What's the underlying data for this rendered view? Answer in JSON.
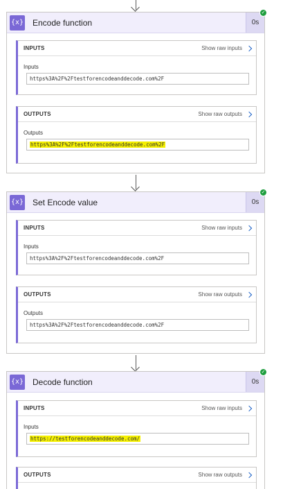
{
  "cards": [
    {
      "title": "Encode function",
      "duration": "0s",
      "inputs": {
        "header": "INPUTS",
        "raw_label": "Show raw inputs",
        "field_label": "Inputs",
        "value": "https%3A%2F%2Ftestforencodeanddecode.com%2F"
      },
      "outputs": {
        "header": "OUTPUTS",
        "raw_label": "Show raw outputs",
        "field_label": "Outputs",
        "value": "https%3A%2F%2Ftestforencodeanddecode.com%2F"
      }
    },
    {
      "title": "Set Encode value",
      "duration": "0s",
      "inputs": {
        "header": "INPUTS",
        "raw_label": "Show raw inputs",
        "field_label": "Inputs",
        "value": "https%3A%2F%2Ftestforencodeanddecode.com%2F"
      },
      "outputs": {
        "header": "OUTPUTS",
        "raw_label": "Show raw outputs",
        "field_label": "Outputs",
        "value": "https%3A%2F%2Ftestforencodeanddecode.com%2F"
      }
    },
    {
      "title": "Decode function",
      "duration": "0s",
      "inputs": {
        "header": "INPUTS",
        "raw_label": "Show raw inputs",
        "field_label": "Inputs",
        "value": "https://testforencodeanddecode.com/"
      },
      "outputs": {
        "header": "OUTPUTS",
        "raw_label": "Show raw outputs"
      }
    }
  ],
  "icons": {
    "action": "{x}",
    "success": "✓",
    "action_icon_name": "expression-icon",
    "raw_chevron_name": "chevron-right-icon"
  },
  "colors": {
    "header_bg": "#f1eefc",
    "action_icon": "#7a68d6",
    "success_badge": "#1f9e3f",
    "highlight": "#f5f000",
    "link_chevron": "#2266c8"
  }
}
